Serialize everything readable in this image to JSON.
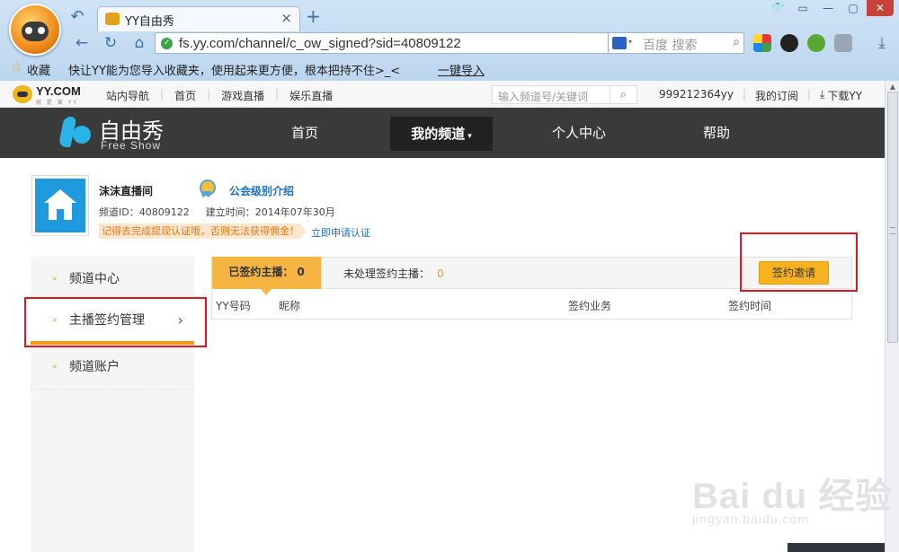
{
  "browser": {
    "tab_title": "YY自由秀",
    "close_glyph": "×",
    "newtab_glyph": "+",
    "url": "fs.yy.com/channel/c_ow_signed?sid=40809122",
    "search_engine_placeholder": "百度 搜索",
    "favorites_label": "收藏",
    "favorites_tip": "快让YY能为您导入收藏夹，使用起来更方便，根本把持不住>_<",
    "favorites_import": "一键导入"
  },
  "site": {
    "logo_text": "YY.COM",
    "logo_sub": "就 是 爱 YY",
    "topnav": [
      "站内导航",
      "首页",
      "游戏直播",
      "娱乐直播"
    ],
    "search_placeholder": "输入频道号/关键词",
    "username": "999212364yy",
    "my_subscriptions": "我的订阅",
    "download": "下载YY",
    "brand_cn": "自由秀",
    "brand_en": "Free Show",
    "mainnav": [
      "首页",
      "我的频道",
      "个人中心",
      "帮助"
    ],
    "dropdown_caret": "▾"
  },
  "channel": {
    "name": "沫沫直播间",
    "guild_intro": "公会级别介绍",
    "id_label": "频道ID：40809122",
    "created_label": "建立时间：2014年07年30月",
    "notice": "记得去完成提现认证哦，否则无法获得佣金！",
    "apply_link": "立即申请认证"
  },
  "sidebar": {
    "items": [
      "频道中心",
      "主播签约管理",
      "频道账户"
    ],
    "bullet": "»",
    "chevron": "›"
  },
  "panel": {
    "signed_label": "已签约主播：",
    "signed_count": "0",
    "pending_label": "未处理签约主播：",
    "pending_count": "0",
    "invite_button": "签约邀请",
    "columns": [
      "YY号码",
      "昵称",
      "签约业务",
      "签约时间"
    ]
  },
  "watermark": {
    "big": "Bai du 经验",
    "small": "jingyan.baidu.com"
  },
  "colors": {
    "accent_orange": "#f6b543",
    "header_dark": "#3a3a3a",
    "highlight_red": "#e8141b",
    "link_blue": "#1a6fc9"
  }
}
